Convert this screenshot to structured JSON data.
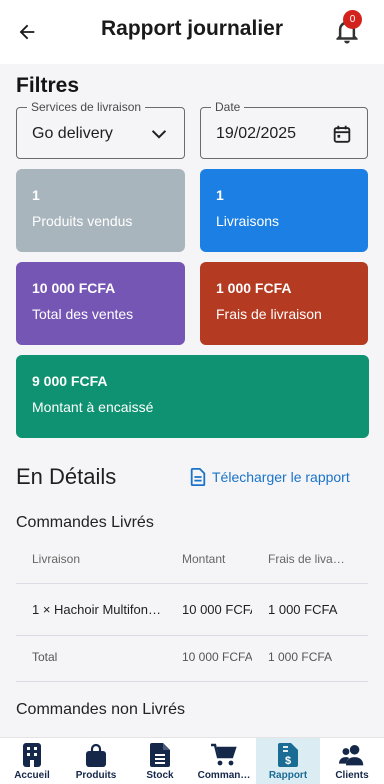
{
  "header": {
    "title": "Rapport journalier",
    "notification_count": "0"
  },
  "filters": {
    "title": "Filtres",
    "delivery_service": {
      "label": "Services de livraison",
      "value": "Go delivery"
    },
    "date": {
      "label": "Date",
      "value": "19/02/2025"
    }
  },
  "stats": [
    {
      "value": "1",
      "label": "Produits vendus",
      "color": "#a9b5bd"
    },
    {
      "value": "1",
      "label": "Livraisons",
      "color": "#1b7fe4"
    },
    {
      "value": "10 000 FCFA",
      "label": "Total des ventes",
      "color": "#7656b5"
    },
    {
      "value": "1 000 FCFA",
      "label": "Frais de livraison",
      "color": "#b43a22"
    },
    {
      "value": "9 000 FCFA",
      "label": "Montant à encaissé",
      "color": "#0e9271"
    }
  ],
  "details": {
    "title": "En Détails",
    "download_label": "Télecharger le rapport",
    "delivered": {
      "title": "Commandes Livrés",
      "columns": [
        "Livraison",
        "Montant",
        "Frais de liva…"
      ],
      "rows": [
        [
          "1 × Hachoir Multifon…",
          "10 000 FCFA",
          "1 000 FCFA"
        ]
      ],
      "total": [
        "Total",
        "10 000 FCFA",
        "1 000 FCFA"
      ]
    },
    "undelivered": {
      "title": "Commandes non Livrés"
    }
  },
  "bottom_nav": [
    {
      "label": "Accueil",
      "icon": "building-icon",
      "active": false
    },
    {
      "label": "Produits",
      "icon": "bag-icon",
      "active": false
    },
    {
      "label": "Stock",
      "icon": "document-list-icon",
      "active": false
    },
    {
      "label": "Comman…",
      "icon": "cart-icon",
      "active": false
    },
    {
      "label": "Rapport",
      "icon": "invoice-dollar-icon",
      "active": true
    },
    {
      "label": "Clients",
      "icon": "users-icon",
      "active": false
    }
  ],
  "colors": {
    "accent": "#1a73c9",
    "badge": "#d3221b",
    "nav_active_bg": "#dcecf3"
  }
}
